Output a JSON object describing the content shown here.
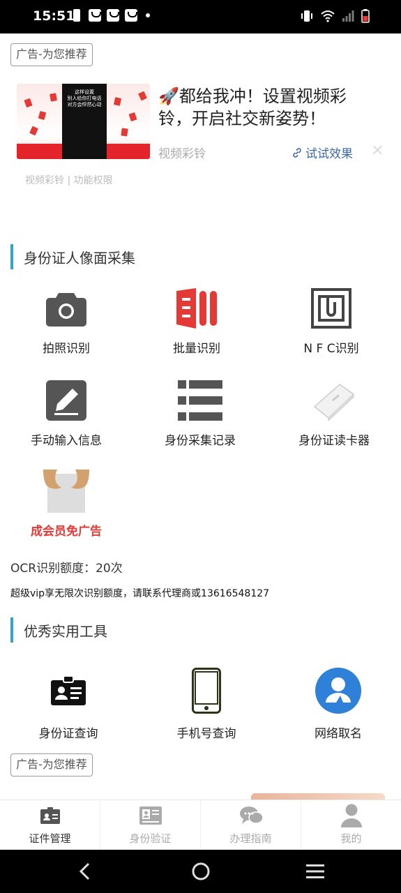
{
  "status_bar": {
    "time": "15:51"
  },
  "ad_top": {
    "tag": "广告-为您推荐",
    "image_caption": "这样设置\n别人给你打电话\n对方会怦然心动",
    "title": "🚀都给我冲！设置视频彩铃，开启社交新姿势！",
    "subtitle": "视频彩铃",
    "link": "试试效果",
    "meta": "视频彩铃 | 功能权限"
  },
  "section1": {
    "title": "身份证人像面采集",
    "items": [
      {
        "label": "拍照识别",
        "icon": "camera-icon"
      },
      {
        "label": "批量识别",
        "icon": "batch-icon"
      },
      {
        "label": "N F C识别",
        "icon": "nfc-icon"
      },
      {
        "label": "手动输入信息",
        "icon": "edit-icon"
      },
      {
        "label": "身份采集记录",
        "icon": "list-icon"
      },
      {
        "label": "身份证读卡器",
        "icon": "card-reader-icon"
      },
      {
        "label": "成会员免广告",
        "icon": "vip-noad-icon",
        "color": "#e53935"
      }
    ]
  },
  "ocr_quota": "OCR识别额度：20次",
  "vip_note": "超级vip享无限次识别额度，请联系代理商或13616548127",
  "section2": {
    "title": "优秀实用工具",
    "items": [
      {
        "label": "身份证查询",
        "icon": "id-card-icon"
      },
      {
        "label": "手机号查询",
        "icon": "phone-icon"
      },
      {
        "label": "网络取名",
        "icon": "user-circle-icon"
      }
    ]
  },
  "ad_bottom": {
    "tag": "广告-为您推荐"
  },
  "tabs": [
    {
      "label": "证件管理",
      "icon": "document-icon",
      "active": true
    },
    {
      "label": "身份验证",
      "icon": "id-verify-icon",
      "active": false
    },
    {
      "label": "办理指南",
      "icon": "chat-icon",
      "active": false
    },
    {
      "label": "我的",
      "icon": "profile-icon",
      "active": false
    }
  ],
  "colors": {
    "accent": "#2ea3d5",
    "red": "#e53935",
    "blue": "#2f80d8"
  }
}
